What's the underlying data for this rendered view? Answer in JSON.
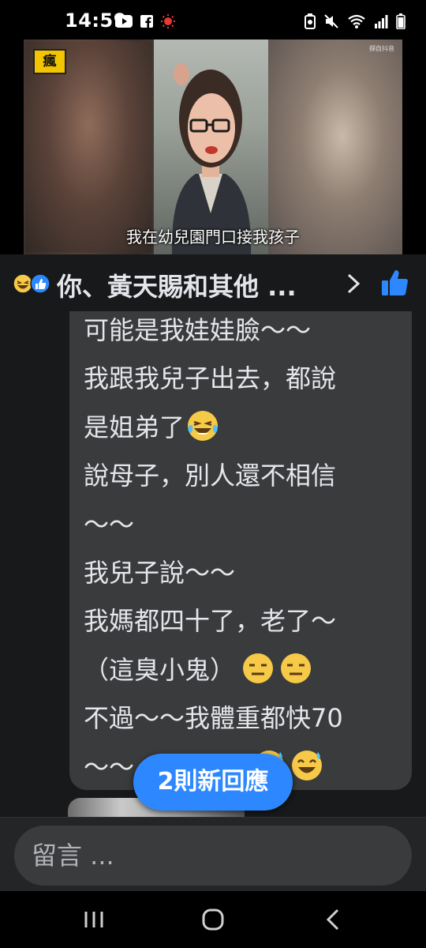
{
  "status_bar": {
    "time": "14:59",
    "left_icons": [
      "youtube-icon",
      "facebook-icon",
      "sun-alert-icon"
    ],
    "right_icons": [
      "battery-saver-icon",
      "mute-icon",
      "wifi-icon",
      "signal-icon",
      "battery-icon"
    ]
  },
  "video": {
    "subtitle": "我在幼兒園門口接我孩子",
    "channel_logo": "瘋",
    "corner_tag": "擷自抖音"
  },
  "header": {
    "reaction_icons": [
      "laughing-emoji-icon",
      "like-reaction-icon"
    ],
    "title": "你、黃天賜和其他 ..."
  },
  "comment": {
    "lines": [
      "可能是我娃娃臉〜〜",
      "我跟我兒子出去，都說",
      "是姐弟了",
      "說母子，別人還不相信",
      "〜〜",
      "我兒子說〜〜",
      "我媽都四十了，老了〜",
      "（這臭小鬼）",
      "不過〜〜我體重都快70",
      "〜〜"
    ]
  },
  "new_replies_label": "2則新回應",
  "composer": {
    "placeholder": "留言 ..."
  },
  "nav": {
    "icons": [
      "recent-apps-icon",
      "home-icon",
      "back-icon"
    ]
  },
  "colors": {
    "background": "#18191a",
    "bubble": "#3a3b3c",
    "accent": "#2d88ff",
    "text": "#e4e6eb"
  }
}
